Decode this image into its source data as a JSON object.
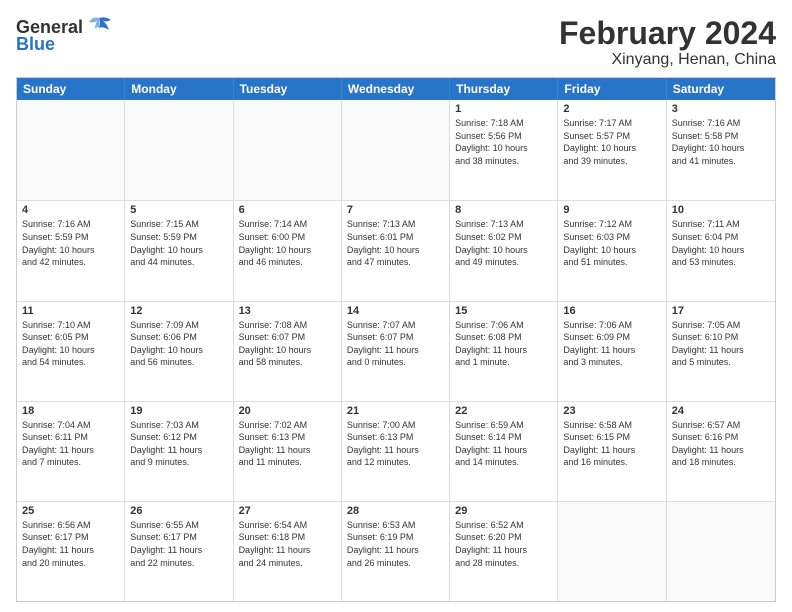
{
  "header": {
    "logo_general": "General",
    "logo_blue": "Blue",
    "month_year": "February 2024",
    "location": "Xinyang, Henan, China"
  },
  "days_of_week": [
    "Sunday",
    "Monday",
    "Tuesday",
    "Wednesday",
    "Thursday",
    "Friday",
    "Saturday"
  ],
  "weeks": [
    [
      {
        "day": "",
        "info": ""
      },
      {
        "day": "",
        "info": ""
      },
      {
        "day": "",
        "info": ""
      },
      {
        "day": "",
        "info": ""
      },
      {
        "day": "1",
        "info": "Sunrise: 7:18 AM\nSunset: 5:56 PM\nDaylight: 10 hours\nand 38 minutes."
      },
      {
        "day": "2",
        "info": "Sunrise: 7:17 AM\nSunset: 5:57 PM\nDaylight: 10 hours\nand 39 minutes."
      },
      {
        "day": "3",
        "info": "Sunrise: 7:16 AM\nSunset: 5:58 PM\nDaylight: 10 hours\nand 41 minutes."
      }
    ],
    [
      {
        "day": "4",
        "info": "Sunrise: 7:16 AM\nSunset: 5:59 PM\nDaylight: 10 hours\nand 42 minutes."
      },
      {
        "day": "5",
        "info": "Sunrise: 7:15 AM\nSunset: 5:59 PM\nDaylight: 10 hours\nand 44 minutes."
      },
      {
        "day": "6",
        "info": "Sunrise: 7:14 AM\nSunset: 6:00 PM\nDaylight: 10 hours\nand 46 minutes."
      },
      {
        "day": "7",
        "info": "Sunrise: 7:13 AM\nSunset: 6:01 PM\nDaylight: 10 hours\nand 47 minutes."
      },
      {
        "day": "8",
        "info": "Sunrise: 7:13 AM\nSunset: 6:02 PM\nDaylight: 10 hours\nand 49 minutes."
      },
      {
        "day": "9",
        "info": "Sunrise: 7:12 AM\nSunset: 6:03 PM\nDaylight: 10 hours\nand 51 minutes."
      },
      {
        "day": "10",
        "info": "Sunrise: 7:11 AM\nSunset: 6:04 PM\nDaylight: 10 hours\nand 53 minutes."
      }
    ],
    [
      {
        "day": "11",
        "info": "Sunrise: 7:10 AM\nSunset: 6:05 PM\nDaylight: 10 hours\nand 54 minutes."
      },
      {
        "day": "12",
        "info": "Sunrise: 7:09 AM\nSunset: 6:06 PM\nDaylight: 10 hours\nand 56 minutes."
      },
      {
        "day": "13",
        "info": "Sunrise: 7:08 AM\nSunset: 6:07 PM\nDaylight: 10 hours\nand 58 minutes."
      },
      {
        "day": "14",
        "info": "Sunrise: 7:07 AM\nSunset: 6:07 PM\nDaylight: 11 hours\nand 0 minutes."
      },
      {
        "day": "15",
        "info": "Sunrise: 7:06 AM\nSunset: 6:08 PM\nDaylight: 11 hours\nand 1 minute."
      },
      {
        "day": "16",
        "info": "Sunrise: 7:06 AM\nSunset: 6:09 PM\nDaylight: 11 hours\nand 3 minutes."
      },
      {
        "day": "17",
        "info": "Sunrise: 7:05 AM\nSunset: 6:10 PM\nDaylight: 11 hours\nand 5 minutes."
      }
    ],
    [
      {
        "day": "18",
        "info": "Sunrise: 7:04 AM\nSunset: 6:11 PM\nDaylight: 11 hours\nand 7 minutes."
      },
      {
        "day": "19",
        "info": "Sunrise: 7:03 AM\nSunset: 6:12 PM\nDaylight: 11 hours\nand 9 minutes."
      },
      {
        "day": "20",
        "info": "Sunrise: 7:02 AM\nSunset: 6:13 PM\nDaylight: 11 hours\nand 11 minutes."
      },
      {
        "day": "21",
        "info": "Sunrise: 7:00 AM\nSunset: 6:13 PM\nDaylight: 11 hours\nand 12 minutes."
      },
      {
        "day": "22",
        "info": "Sunrise: 6:59 AM\nSunset: 6:14 PM\nDaylight: 11 hours\nand 14 minutes."
      },
      {
        "day": "23",
        "info": "Sunrise: 6:58 AM\nSunset: 6:15 PM\nDaylight: 11 hours\nand 16 minutes."
      },
      {
        "day": "24",
        "info": "Sunrise: 6:57 AM\nSunset: 6:16 PM\nDaylight: 11 hours\nand 18 minutes."
      }
    ],
    [
      {
        "day": "25",
        "info": "Sunrise: 6:56 AM\nSunset: 6:17 PM\nDaylight: 11 hours\nand 20 minutes."
      },
      {
        "day": "26",
        "info": "Sunrise: 6:55 AM\nSunset: 6:17 PM\nDaylight: 11 hours\nand 22 minutes."
      },
      {
        "day": "27",
        "info": "Sunrise: 6:54 AM\nSunset: 6:18 PM\nDaylight: 11 hours\nand 24 minutes."
      },
      {
        "day": "28",
        "info": "Sunrise: 6:53 AM\nSunset: 6:19 PM\nDaylight: 11 hours\nand 26 minutes."
      },
      {
        "day": "29",
        "info": "Sunrise: 6:52 AM\nSunset: 6:20 PM\nDaylight: 11 hours\nand 28 minutes."
      },
      {
        "day": "",
        "info": ""
      },
      {
        "day": "",
        "info": ""
      }
    ]
  ]
}
